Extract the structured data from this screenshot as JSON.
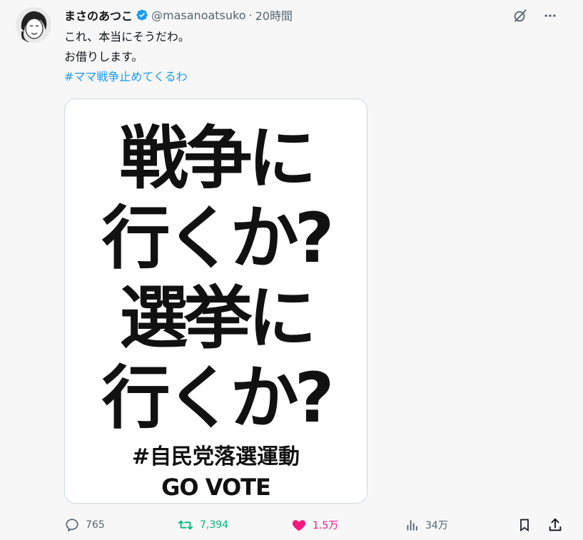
{
  "post": {
    "author_name": "まさのあつこ",
    "author_handle": "@masanoatsuko",
    "separator": "·",
    "time": "20時間",
    "text_lines": [
      "これ、本当にそうだわ。",
      "お借りします。"
    ],
    "hashtag": "#ママ戦争止めてくるわ"
  },
  "media": {
    "line1": "戦争に",
    "line2": "行くか?",
    "line3": "選挙に",
    "line4": "行くか?",
    "tag": "#自民党落選運動",
    "cta": "GO VOTE"
  },
  "actions": {
    "replies": "765",
    "reposts": "7,394",
    "likes": "1.5万",
    "views": "34万"
  },
  "colors": {
    "accent": "#1d9bf0",
    "repost": "#00ba7c",
    "like": "#f91880",
    "muted": "#536471"
  },
  "icons": [
    "verified-badge-icon",
    "grok-icon",
    "more-icon",
    "reply-icon",
    "repost-icon",
    "like-icon",
    "views-icon",
    "bookmark-icon",
    "share-icon"
  ]
}
